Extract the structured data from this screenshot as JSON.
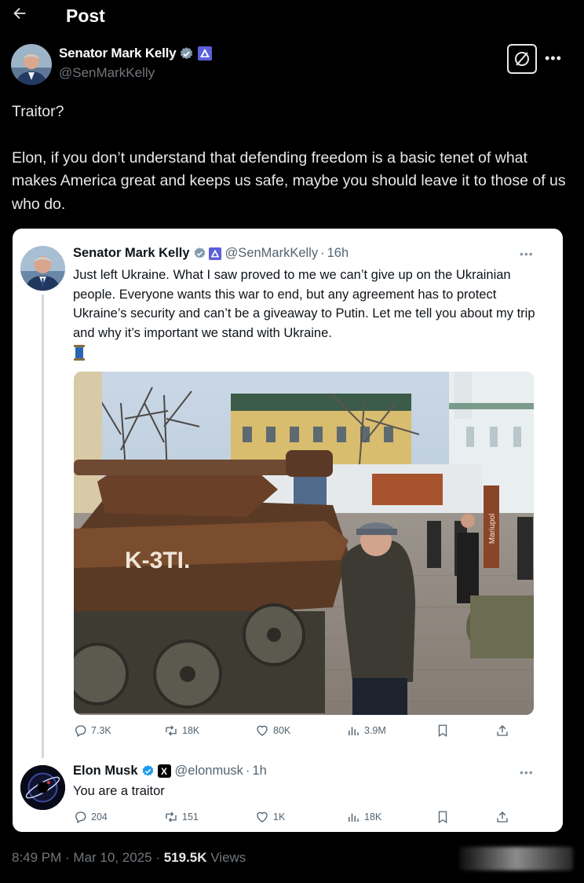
{
  "header": {
    "title": "Post"
  },
  "author": {
    "name": "Senator Mark Kelly",
    "handle": "@SenMarkKelly"
  },
  "tweet": {
    "line1": "Traitor?",
    "line2": "Elon, if you don’t understand that defending freedom is a basic tenet of what makes America great and keeps us safe, maybe you should leave it to those of us who do."
  },
  "quoted": {
    "name": "Senator Mark Kelly",
    "handle": "@SenMarkKelly",
    "sep": "·",
    "time": "16h",
    "text": "Just left Ukraine. What I saw proved to me we can’t give up on the Ukrainian people. Everyone wants this war to end, but any agreement has to protect Ukraine’s security and can’t be a giveaway to Putin. Let me tell you about my trip and why it’s important we stand with Ukraine.",
    "emoji_icon": "thread-spool-icon",
    "photo_sign": "Mariupol",
    "photo_tank_text": "K-3TI.",
    "stats": {
      "replies": "7.3K",
      "reposts": "18K",
      "likes": "80K",
      "views": "3.9M"
    }
  },
  "reply": {
    "name": "Elon Musk",
    "handle": "@elonmusk",
    "sep": "·",
    "time": "1h",
    "text": "You are a traitor",
    "stats": {
      "replies": "204",
      "reposts": "151",
      "likes": "1K",
      "views": "18K"
    }
  },
  "footer": {
    "time": "8:49 PM",
    "dot1": " · ",
    "date": "Mar 10, 2025",
    "dot2": " · ",
    "views_count": "519.5K",
    "views_label": " Views"
  },
  "colors": {
    "verified": "#1d9bf0",
    "government": "#5b5fd9",
    "background": "#000000",
    "card": "#ffffff"
  }
}
